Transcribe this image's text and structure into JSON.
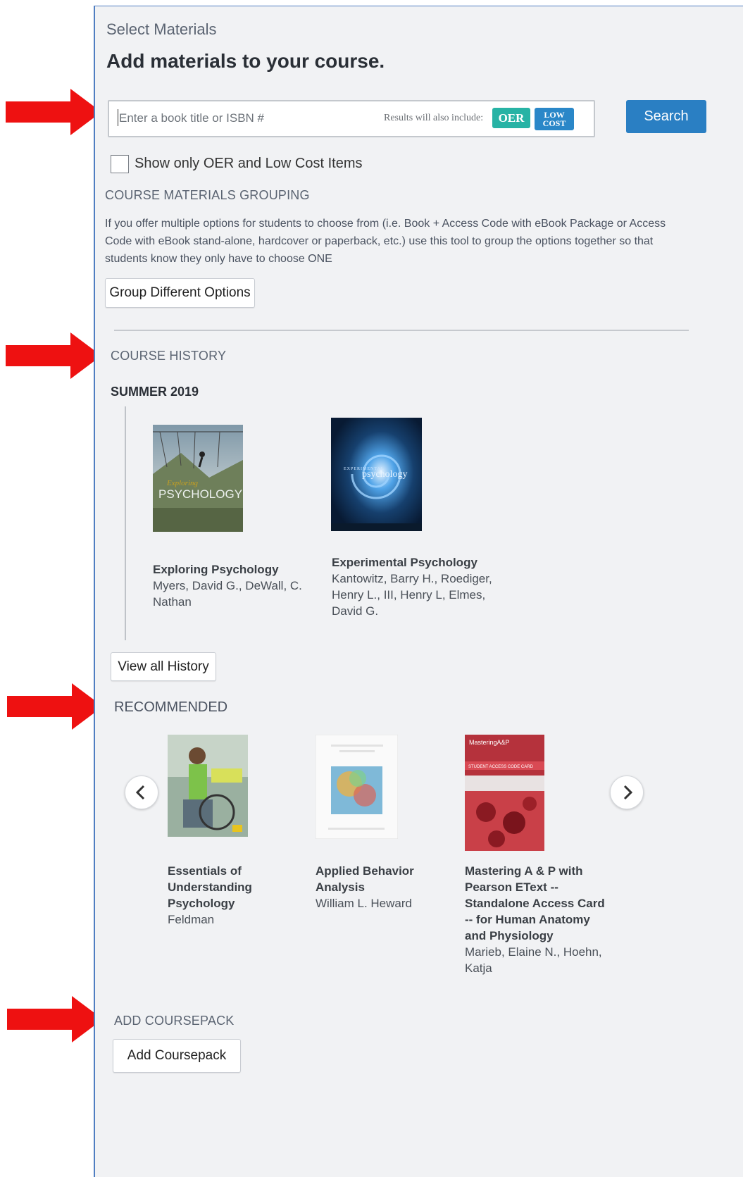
{
  "header": {
    "eyebrow": "Select Materials",
    "title": "Add materials to your course."
  },
  "search": {
    "placeholder": "Enter a book title or ISBN #",
    "also_include": "Results will also include:",
    "badge_oer": "OER",
    "badge_low_line1": "LOW",
    "badge_low_line2": "COST",
    "button": "Search"
  },
  "filter": {
    "label": "Show only OER and Low Cost Items"
  },
  "grouping": {
    "label": "COURSE MATERIALS GROUPING",
    "description": "If you offer multiple options for students to choose from (i.e. Book + Access Code with eBook Package or Access Code with eBook stand-alone, hardcover or paperback, etc.) use this tool to group the options together so that students know they only have to choose ONE",
    "button": "Group Different Options"
  },
  "history": {
    "label": "COURSE HISTORY",
    "term": "SUMMER 2019",
    "books": [
      {
        "title": "Exploring Psychology",
        "author": "Myers, David G., DeWall, C. Nathan",
        "cover_text": "PSYCHOLOGY",
        "cover_script": "Exploring"
      },
      {
        "title": "Experimental Psychology",
        "author": "Kantowitz, Barry H., Roediger, Henry L., III, Henry L, Elmes, David G.",
        "cover_text": "psychology",
        "cover_script": "EXPERIMENTAL"
      }
    ],
    "view_all": "View all History"
  },
  "recommended": {
    "label": "RECOMMENDED",
    "books": [
      {
        "title": "Essentials of Understanding Psychology",
        "author": "Feldman"
      },
      {
        "title": "Applied Behavior Analysis",
        "author": "William L. Heward"
      },
      {
        "title": "Mastering A & P with Pearson EText -- Standalone Access Card -- for Human Anatomy and Physiology",
        "author": "Marieb, Elaine N., Hoehn, Katja",
        "cover_brand": "MasteringA&P",
        "cover_banner": "STUDENT ACCESS CODE CARD"
      }
    ]
  },
  "coursepack": {
    "label": "ADD COURSEPACK",
    "button": "Add Coursepack"
  },
  "colors": {
    "accent": "#2a7fc3",
    "oer": "#27b3a5",
    "low_cost": "#2a87c8",
    "arrow": "#ee1111"
  }
}
